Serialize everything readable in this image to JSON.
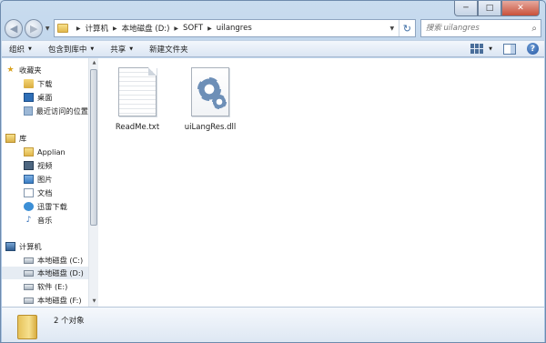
{
  "window": {
    "caption": {
      "minimize": "─",
      "maximize": "□",
      "close": "✕"
    }
  },
  "nav": {
    "back_icon": "back-arrow-icon",
    "forward_icon": "forward-arrow-icon",
    "breadcrumb": [
      "计算机",
      "本地磁盘 (D:)",
      "SOFT",
      "uilangres"
    ],
    "search_placeholder": "搜索 uilangres"
  },
  "toolbar": {
    "organize": "组织",
    "include_in_library": "包含到库中",
    "share": "共享",
    "new_folder": "新建文件夹"
  },
  "sidebar": {
    "favorites": {
      "label": "收藏夹",
      "items": [
        "下载",
        "桌面",
        "最近访问的位置"
      ]
    },
    "libraries": {
      "label": "库",
      "items": [
        "Applian",
        "视频",
        "图片",
        "文档",
        "迅雷下载",
        "音乐"
      ]
    },
    "computer": {
      "label": "计算机",
      "items": [
        "本地磁盘 (C:)",
        "本地磁盘 (D:)",
        "软件 (E:)",
        "本地磁盘 (F:)"
      ],
      "selected": "本地磁盘 (D:)"
    }
  },
  "files": [
    {
      "name": "ReadMe.txt",
      "icon": "text-file-icon"
    },
    {
      "name": "uiLangRes.dll",
      "icon": "dll-file-icon"
    }
  ],
  "details": {
    "count": "2 个对象"
  },
  "colors": {
    "close": "#c9513b",
    "selection": "#e6ecf3",
    "link": "#3f6fa6"
  }
}
